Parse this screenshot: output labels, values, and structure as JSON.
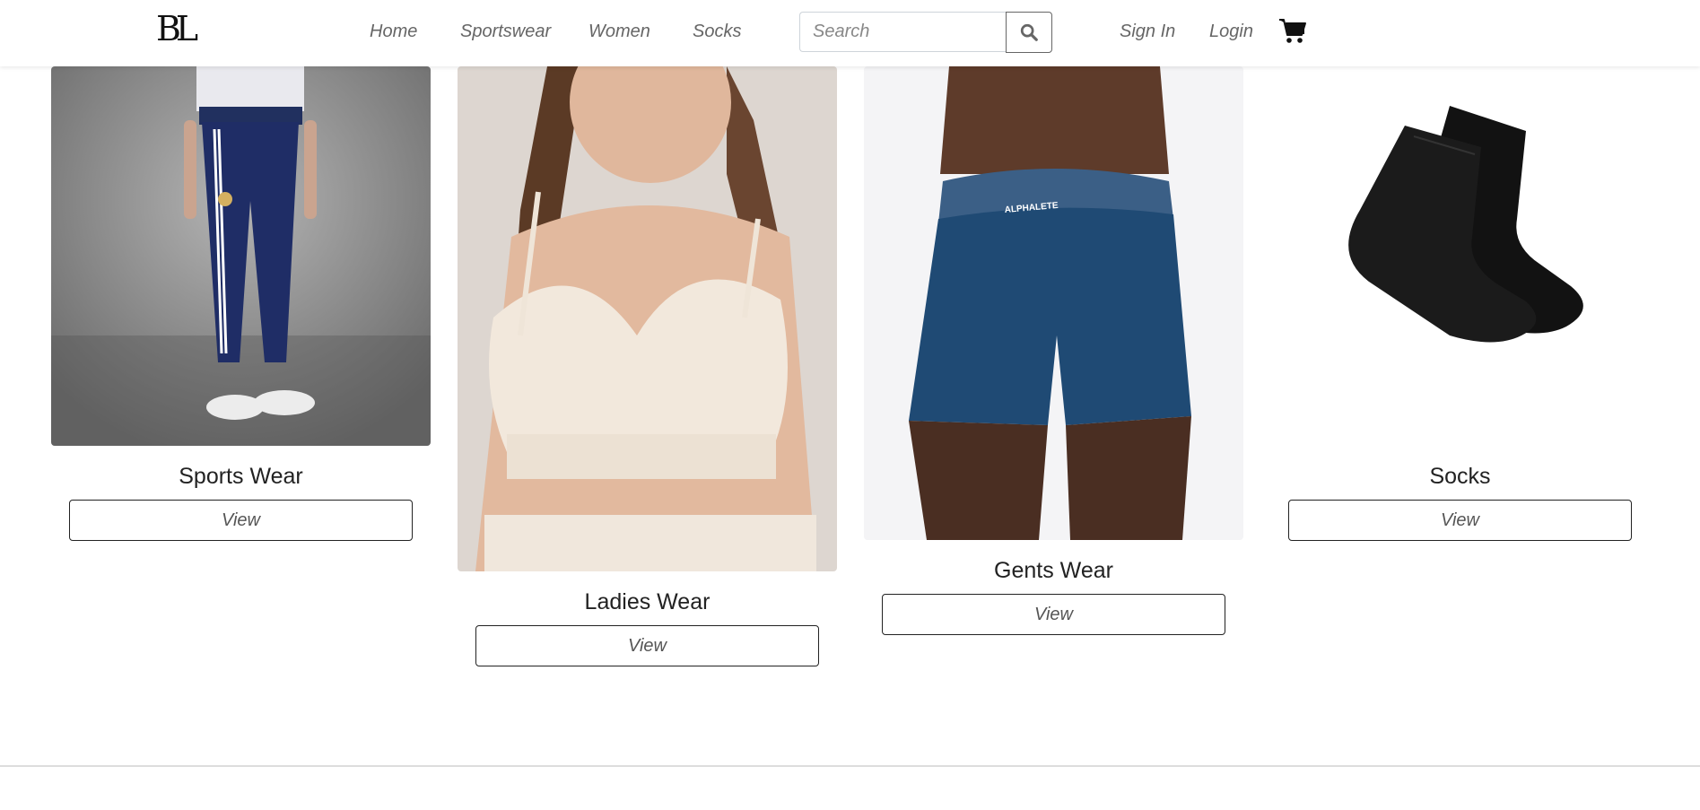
{
  "nav": {
    "logo": "BL",
    "links": [
      "Home",
      "Sportswear",
      "Women",
      "Socks"
    ],
    "search_placeholder": "Search",
    "sign_in": "Sign In",
    "login": "Login"
  },
  "categories": [
    {
      "title": "Sports Wear",
      "button": "View"
    },
    {
      "title": "Ladies Wear",
      "button": "View"
    },
    {
      "title": "Gents Wear",
      "button": "View"
    },
    {
      "title": "Socks",
      "button": "View"
    }
  ],
  "product_print": "ALPHALETE"
}
